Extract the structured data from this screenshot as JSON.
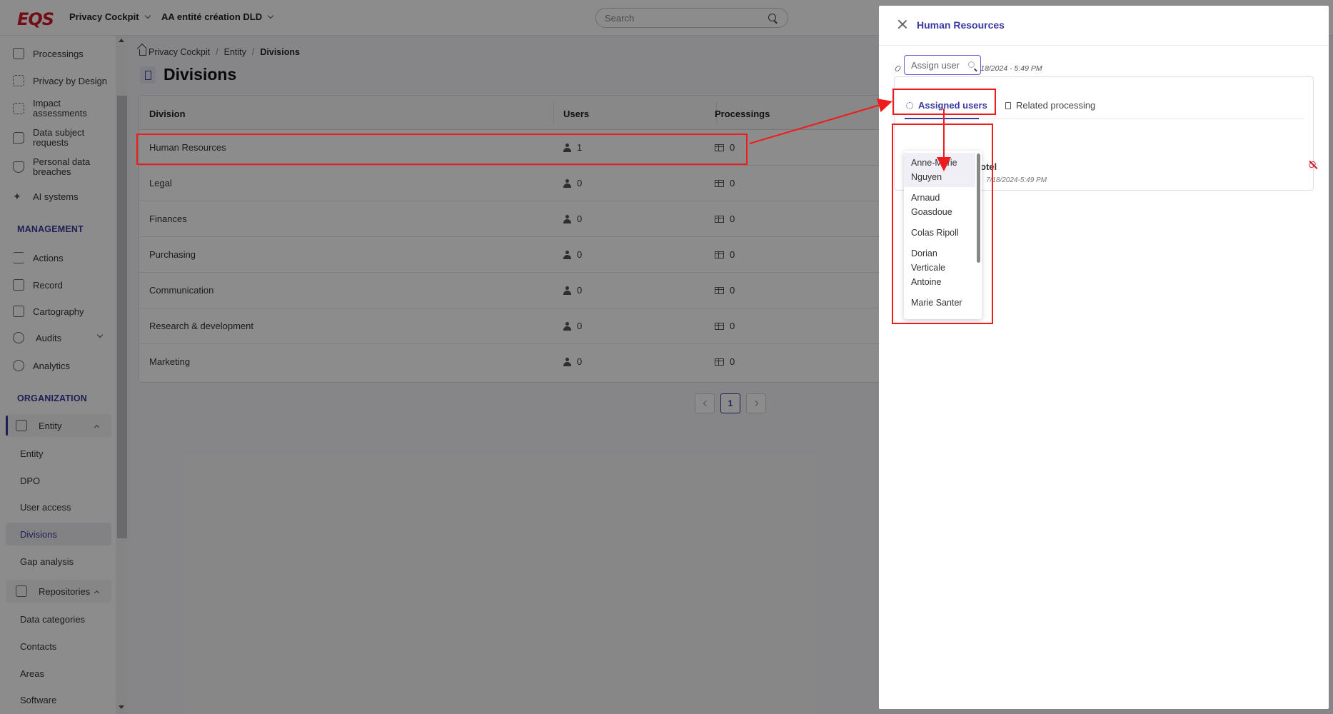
{
  "topbar": {
    "app_dropdown": "Privacy Cockpit",
    "entity_dropdown": "AA entité création DLD",
    "search_placeholder": "Search"
  },
  "sidebar": {
    "items": [
      {
        "label": "Processings",
        "icon": "file-icon"
      },
      {
        "label": "Privacy by Design",
        "icon": "design-icon"
      },
      {
        "label": "Impact assessments",
        "icon": "impact-icon"
      },
      {
        "label": "Data subject requests",
        "icon": "chat-icon"
      },
      {
        "label": "Personal data breaches",
        "icon": "shield-icon"
      },
      {
        "label": "AI systems",
        "icon": "sparkle-icon"
      }
    ],
    "management_title": "MANAGEMENT",
    "management_items": [
      {
        "label": "Actions",
        "icon": "list-icon"
      },
      {
        "label": "Record",
        "icon": "table-icon"
      },
      {
        "label": "Cartography",
        "icon": "map-icon"
      },
      {
        "label": "Audits",
        "icon": "check-circle-icon"
      },
      {
        "label": "Analytics",
        "icon": "analytics-icon"
      }
    ],
    "organization_title": "ORGANIZATION",
    "entity_group": "Entity",
    "entity_subitems": [
      "Entity",
      "DPO",
      "User access",
      "Divisions",
      "Gap analysis"
    ],
    "repositories_group": "Repositories",
    "repositories_subitems": [
      "Data categories",
      "Contacts",
      "Areas",
      "Software"
    ]
  },
  "breadcrumb": {
    "home": "Privacy Cockpit",
    "sep": "/",
    "entity": "Entity",
    "current": "Divisions"
  },
  "page_title": "Divisions",
  "table": {
    "headers": [
      "Division",
      "Users",
      "Processings"
    ],
    "rows": [
      {
        "division": "Human Resources",
        "users": "1",
        "processings": "0"
      },
      {
        "division": "Legal",
        "users": "0",
        "processings": "0"
      },
      {
        "division": "Finances",
        "users": "0",
        "processings": "0"
      },
      {
        "division": "Purchasing",
        "users": "0",
        "processings": "0"
      },
      {
        "division": "Communication",
        "users": "0",
        "processings": "0"
      },
      {
        "division": "Research & development",
        "users": "0",
        "processings": "0"
      },
      {
        "division": "Marketing",
        "users": "0",
        "processings": "0"
      }
    ]
  },
  "pagination": {
    "current": "1"
  },
  "drawer": {
    "title": "Human Resources",
    "assigned_note": "division assigned on 7/18/2024 - 5:49 PM",
    "tab_assigned": "Assigned users",
    "tab_related": "Related processing",
    "assign_placeholder": "Assign user",
    "behind_name_fragment": "otel",
    "behind_date_fragment": "7/18/2024-5:49 PM"
  },
  "dropdown": {
    "options": [
      {
        "line1": "Anne-Marie",
        "line2": "Nguyen"
      },
      {
        "line1": "Arnaud",
        "line2": "Goasdoue"
      },
      {
        "line1": "Colas Ripoll"
      },
      {
        "line1": "Dorian",
        "line2": "Verticale",
        "line3": "Antoine"
      },
      {
        "line1": "Marie Santer"
      }
    ]
  },
  "colors": {
    "accent": "#3a3aa0",
    "brand_red": "#d11a2a",
    "annotation_red": "#ee1c1c"
  }
}
